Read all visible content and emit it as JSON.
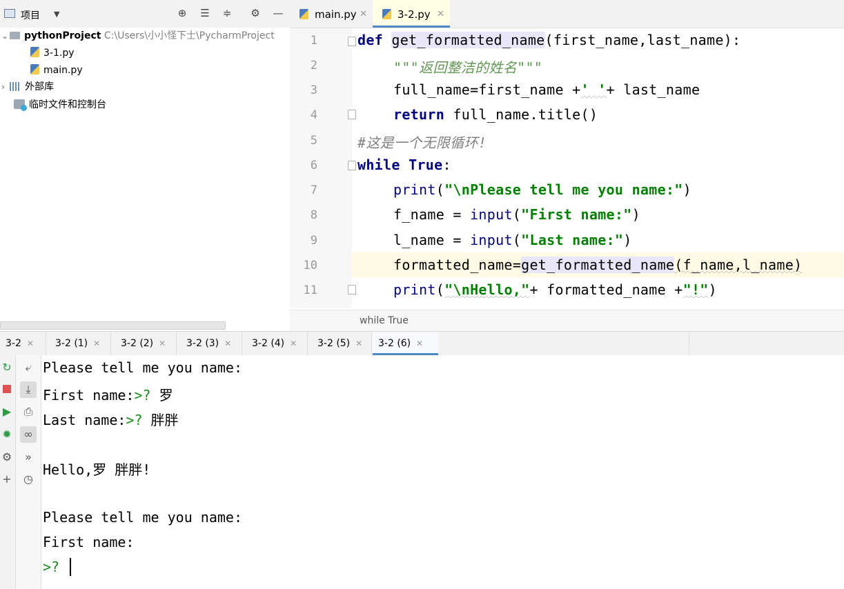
{
  "project": {
    "title": "项目",
    "root_name": "pythonProject",
    "root_path": "C:\\Users\\小小怪下士\\PycharmProject",
    "files": [
      "3-1.py",
      "main.py"
    ],
    "external_libs": "外部库",
    "scratches": "临时文件和控制台"
  },
  "editor": {
    "tabs": [
      {
        "label": "main.py",
        "active": false
      },
      {
        "label": "3-2.py",
        "active": true
      }
    ],
    "line_numbers": [
      "1",
      "2",
      "3",
      "4",
      "5",
      "6",
      "7",
      "8",
      "9",
      "10",
      "11"
    ],
    "lines": {
      "l1_kw": "def",
      "l1_fn": "get_formatted_name",
      "l1_rest": "(first_name,last_name):",
      "l2_doc": "\"\"\"返回整洁的姓名\"\"\"",
      "l3_a": "full_name=first_name +",
      "l3_str": "' '",
      "l3_b": "+ last_name",
      "l4_kw": "return",
      "l4_rest": " full_name.title()",
      "l5_cmt": "#这是一个无限循环!",
      "l6_kw1": "while",
      "l6_kw2": "True",
      "l6_rest": ":",
      "l7_fn": "print",
      "l7_open": "(",
      "l7_str": "\"\\nPlease tell me you name:\"",
      "l7_close": ")",
      "l8_a": "f_name = ",
      "l8_fn": "input",
      "l8_open": "(",
      "l8_str": "\"First name:\"",
      "l8_close": ")",
      "l9_a": "l_name = ",
      "l9_fn": "input",
      "l9_open": "(",
      "l9_str": "\"Last name:\"",
      "l9_close": ")",
      "l10_a": "formatted_name=",
      "l10_fn": "get_formatted_name",
      "l10_rest": "(f_name,l_name)",
      "l11_fn": "print",
      "l11_open": "(",
      "l11_str": "\"\\nHello,\"",
      "l11_b": "+ formatted_name +",
      "l11_str2": "\"!\"",
      "l11_close": ")"
    },
    "breadcrumb": "while True"
  },
  "run_tabs": [
    "3-2",
    "3-2 (1)",
    "3-2 (2)",
    "3-2 (3)",
    "3-2 (4)",
    "3-2 (5)",
    "3-2 (6)"
  ],
  "active_run_tab": "3-2 (6)",
  "console": {
    "lines": [
      {
        "prompt": "",
        "text": "Please tell me you name:"
      },
      {
        "prompt": ">? ",
        "pre": "First name:",
        "text": "罗"
      },
      {
        "prompt": ">? ",
        "pre": "Last name:",
        "text": "胖胖"
      },
      {
        "prompt": "",
        "text": ""
      },
      {
        "prompt": "",
        "text": "Hello,罗 胖胖!"
      },
      {
        "prompt": "",
        "text": ""
      },
      {
        "prompt": "",
        "text": "Please tell me you name:"
      },
      {
        "prompt": "",
        "text": "First name:"
      },
      {
        "prompt": ">? ",
        "text": ""
      }
    ]
  },
  "colors": {
    "accent": "#4a88c7",
    "keyword": "#000080",
    "string": "#008000",
    "comment": "#808080"
  }
}
